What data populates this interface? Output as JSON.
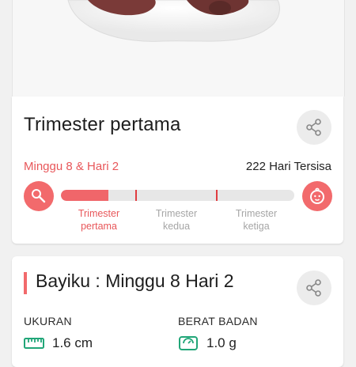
{
  "trimester_card": {
    "title": "Trimester pertama",
    "week_label": "Minggu 8 & Hari 2",
    "remaining_label": "222 Hari Tersisa",
    "progress_fraction": 0.205,
    "segments": [
      {
        "line1": "Trimester",
        "line2": "pertama",
        "active": true
      },
      {
        "line1": "Trimester",
        "line2": "kedua",
        "active": false
      },
      {
        "line1": "Trimester",
        "line2": "ketiga",
        "active": false
      }
    ],
    "start_icon": "baby-rattle-icon",
    "end_icon": "baby-face-icon",
    "share_icon": "share-icon"
  },
  "baby_card": {
    "title": "Bayiku : Minggu 8 Hari 2",
    "share_icon": "share-icon",
    "size_label": "UKURAN",
    "size_value": "1.6 cm",
    "size_icon": "ruler-icon",
    "weight_label": "BERAT BADAN",
    "weight_value": "1.0 g",
    "weight_icon": "scale-icon"
  },
  "colors": {
    "accent": "#f26a6c",
    "accent_text": "#e8575a",
    "inactive": "#a6a6a6"
  }
}
